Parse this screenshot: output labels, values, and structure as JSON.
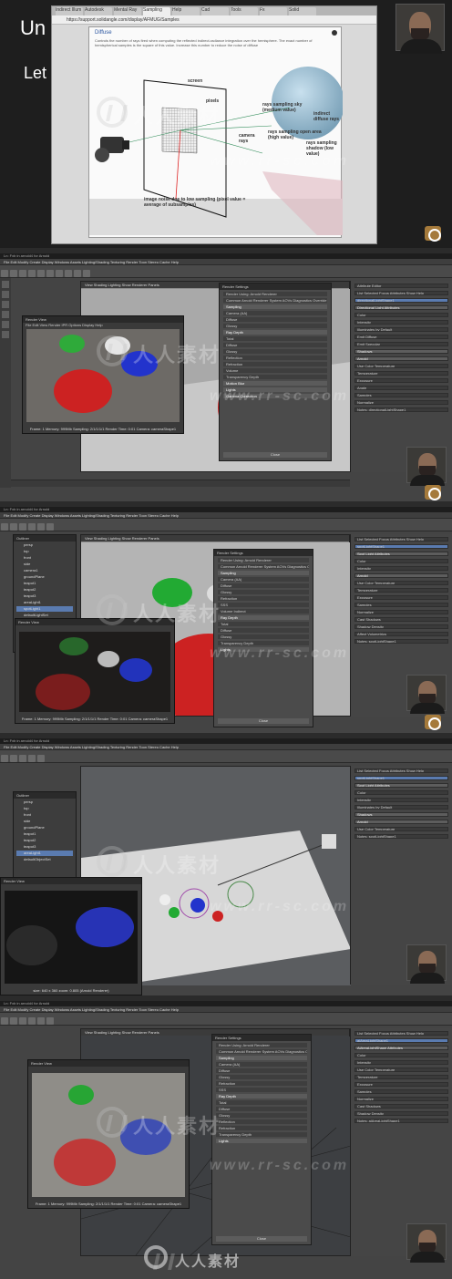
{
  "panel1": {
    "slide_text_1": "Un",
    "slide_text_2": "Let",
    "browser_tabs": [
      "Indirect Illum",
      "Autodesk",
      "Mental Ray",
      "Sampling",
      "Help",
      "Cad",
      "Tools",
      "Fx",
      "Solid"
    ],
    "active_tab": "Sampling",
    "url": "https://support.solidangle.com/display/AFMUG/Samples",
    "dialog_title": "Diffuse",
    "dialog_text": "Controls the number of rays fired when computing the reflected indirect-radiance integration over the hemisphere. The exact number of hemispherical samples is the square of this value. Increase this number to reduce the noise of diffuse",
    "labels": {
      "screen": "screen",
      "pixels": "pixels",
      "camera_rays": "camera rays",
      "sky": "rays sampling sky (medium value)",
      "indirect": "indirect diffuse rays",
      "open_area": "rays sampling open area (high value)",
      "shadow": "rays sampling shadow (low value)",
      "noise": "image noise due to low sampling (pixel value = average of subsamples)"
    }
  },
  "maya": {
    "menu": "File  Edit  Modify  Create  Display  Windows  Assets  Lighting/Shading  Texturing  Render  Toon  Stereo  Cache  Help",
    "viewport_menu": "View  Shading  Lighting  Show  Renderer  Panels",
    "render_settings_title": "Render Settings",
    "render_settings_renderer": "Render Using: Arnold Renderer",
    "render_settings_tabs": "Common  Arnold Renderer  System  AOVs  Diagnostics  Override",
    "sampling_header": "Sampling",
    "sampling_rows": [
      "Camera (AA)",
      "Diffuse",
      "Glossy",
      "Refraction",
      "SSS",
      "Volume Indirect"
    ],
    "ray_depth_header": "Ray Depth",
    "ray_depth_rows": [
      "Total",
      "Diffuse",
      "Glossy",
      "Reflection",
      "Refraction",
      "Volume",
      "Transparency Depth"
    ],
    "motion_blur": "Motion Blur",
    "lights": "Lights",
    "gamma_correction": "Gamma Correction",
    "close_button": "Close",
    "renderview_title": "Render View",
    "renderview_menu": "File  Edit  View  Render  IPR  Options  Display  Help",
    "frame_caption": "Frame: 1   Memory: 999Mb   Sampling: 2/1/1/1/1   Render Time: 0:01   Camera: cameraShape1",
    "attr_editor_title": "Attribute Editor",
    "attr_tabs": "List  Selected  Focus  Attributes  Show  Help",
    "light_node": "directionalLightShape1",
    "light_attrs_header": "Directional Light Attributes",
    "light_attrs": [
      "Color",
      "Intensity",
      "Illuminates by Default",
      "Emit Diffuse",
      "Emit Specular"
    ],
    "shadows": "Shadows",
    "arnold": "Arnold",
    "arnold_attrs": [
      "Use Color Temperature",
      "Temperature",
      "Exposure",
      "Angle",
      "Samples",
      "Normalize",
      "Cast Shadows",
      "Shadow Density",
      "Affect Volumetrics"
    ],
    "notes": "Notes: directionalLightShape1",
    "outliner_title": "Outliner",
    "outliner_menu": "Display  Show  Help",
    "outliner_items": [
      "persp",
      "top",
      "front",
      "side",
      "camera1",
      "groundPlane",
      "teapot1",
      "teapot2",
      "teapot3",
      "areaLight1",
      "spotLight1",
      "defaultLightSet",
      "defaultObjectSet"
    ],
    "spot_light_node": "spotLightShape1",
    "spot_attrs_header": "Spot Light Attributes",
    "notes_spot": "Notes: spotLightShape1",
    "area_node": "aiAreaLightShape1",
    "area_attrs_header": "AiAreaLightShape Attributes",
    "notes_area": "Notes: aiAreaLightShape1",
    "status": "Ln: Fxb in arnold4 for Arnold",
    "renderview_size": "size: 640 x 360 zoom: 0.805  (Arnold Renderer)"
  },
  "watermark": {
    "brand_cn": "人人素材",
    "brand_url": "www.rr-sc.com"
  },
  "colors": {
    "maya_bg": "#444444",
    "teapot_red": "#cc2222",
    "teapot_green": "#22aa33",
    "teapot_blue": "#2233cc",
    "sphere_blue": "#8fb3c9",
    "logo_orange": "#a57a3b"
  }
}
